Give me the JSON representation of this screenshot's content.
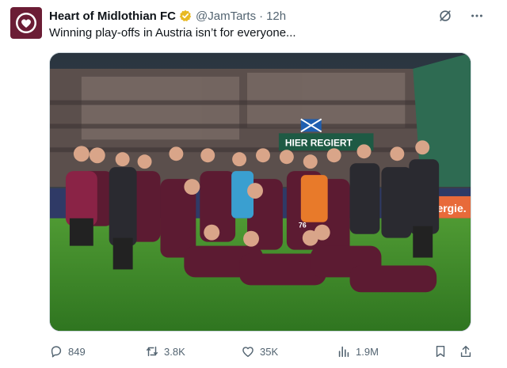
{
  "account": {
    "display_name": "Heart of Midlothian FC",
    "handle": "@JamTarts",
    "separator": "·",
    "time": "12h",
    "verified_icon": "verified-badge-icon"
  },
  "tweet": {
    "text": "Winning play-offs in Austria isn’t for everyone..."
  },
  "media": {
    "banner_text": "HIER REGIERT",
    "sponsor_text": "energie.",
    "jersey_number": "76"
  },
  "stats": {
    "replies": "849",
    "retweets": "3.8K",
    "likes": "35K",
    "views": "1.9M"
  },
  "colors": {
    "brand_maroon": "#6b1d35",
    "muted_text": "#536471",
    "grass": "#3f8a2a",
    "verified_gold": "#e8b923"
  },
  "icons": {
    "reply": "reply-icon",
    "retweet": "retweet-icon",
    "like": "heart-icon",
    "views": "views-icon",
    "bookmark": "bookmark-icon",
    "share": "share-icon",
    "grok": "grok-icon",
    "more": "more-icon"
  }
}
